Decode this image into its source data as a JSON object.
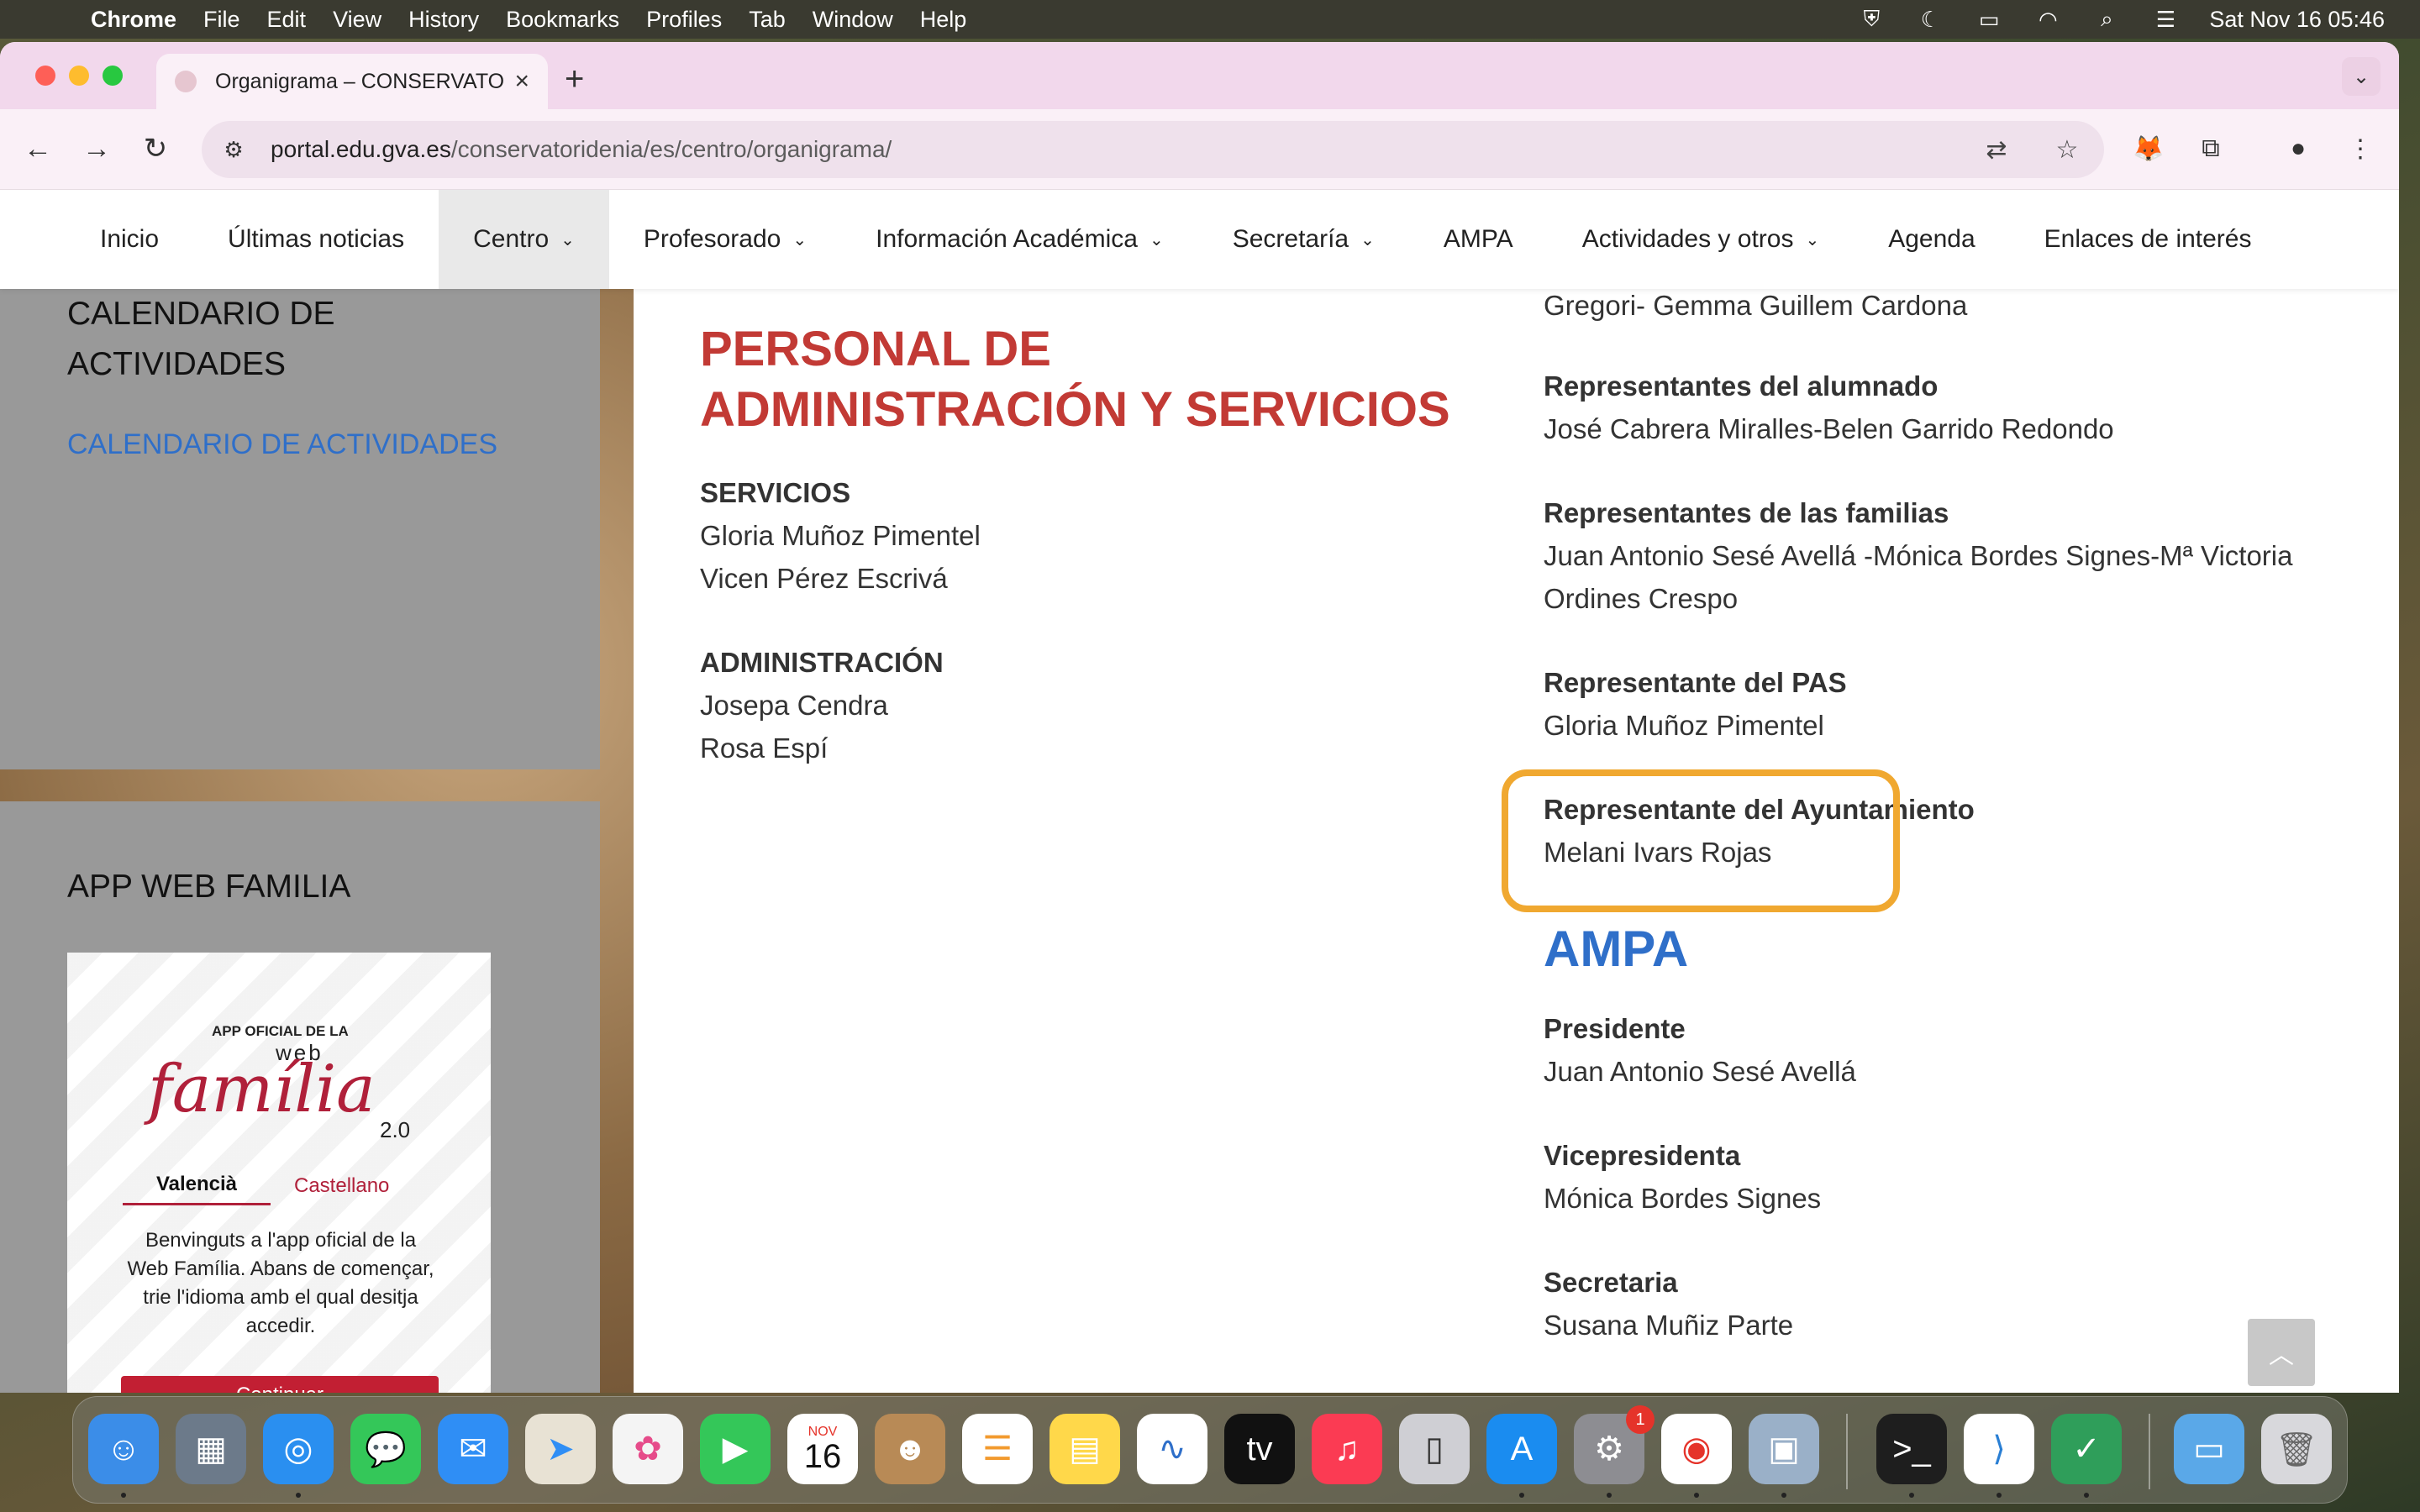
{
  "menubar": {
    "app": "Chrome",
    "items": [
      "File",
      "Edit",
      "View",
      "History",
      "Bookmarks",
      "Profiles",
      "Tab",
      "Window",
      "Help"
    ],
    "datetime": "Sat Nov 16  05:46"
  },
  "browser": {
    "tab_title": "Organigrama – CONSERVATO",
    "url_host": "portal.edu.gva.es",
    "url_path": "/conservatoridenia/es/centro/organigrama/"
  },
  "sitenav": {
    "items": [
      {
        "label": "Inicio"
      },
      {
        "label": "Últimas noticias"
      },
      {
        "label": "Centro"
      },
      {
        "label": "Profesorado"
      },
      {
        "label": "Información Académica"
      },
      {
        "label": "Secretaría"
      },
      {
        "label": "AMPA"
      },
      {
        "label": "Actividades y otros"
      },
      {
        "label": "Agenda"
      },
      {
        "label": "Enlaces de interés"
      }
    ]
  },
  "sidebar": {
    "calendar_title": "CALENDARIO DE ACTIVIDADES",
    "calendar_link": "CALENDARIO DE ACTIVIDADES",
    "app_title": "APP WEB FAMILIA",
    "app_card": {
      "small": "APP OFICIAL DE LA",
      "web": "web",
      "name": "família",
      "version": "2.0",
      "lang1": "Valencià",
      "lang2": "Castellano",
      "message": "Benvinguts a l'app oficial de la Web Família. Abans de començar, trie l'idioma amb el qual desitja accedir.",
      "button": "Continuar"
    }
  },
  "main": {
    "pas_title": "PERSONAL DE ADMINISTRACIÓN Y SERVICIOS",
    "servicios_h": "SERVICIOS",
    "servicios": [
      "Gloria Muñoz Pimentel",
      "Vicen Pérez Escrivá"
    ],
    "admin_h": "ADMINISTRACIÓN",
    "admin": [
      "Josepa Cendra",
      "Rosa Espí"
    ],
    "right_top": "Gregori- Gemma Guillem Cardona",
    "alumnado_h": "Representantes del alumnado",
    "alumnado": "José Cabrera Miralles-Belen Garrido Redondo",
    "familias_h": "Representantes de las familias",
    "familias": "Juan Antonio Sesé Avellá -Mónica Bordes Signes-Mª Victoria Ordines Crespo",
    "pas_h": "Representante del PAS",
    "pas": "Gloria Muñoz Pimentel",
    "ayto_h": "Representante del Ayuntamiento",
    "ayto": "Melani Ivars Rojas",
    "ampa_title": "AMPA",
    "pres_h": "Presidente",
    "pres": "Juan Antonio Sesé Avellá",
    "vice_h": "Vicepresidenta",
    "vice": "Mónica Bordes Signes",
    "secr_h": "Secretaria",
    "secr": "Susana Muñiz Parte"
  },
  "dock": {
    "calendar_month": "NOV",
    "calendar_day": "16",
    "settings_badge": "1"
  },
  "colors": {
    "accent_red": "#c23a35",
    "accent_blue": "#2f6fc9",
    "highlight": "#f0a830",
    "tabbar": "#f2d8ec"
  }
}
